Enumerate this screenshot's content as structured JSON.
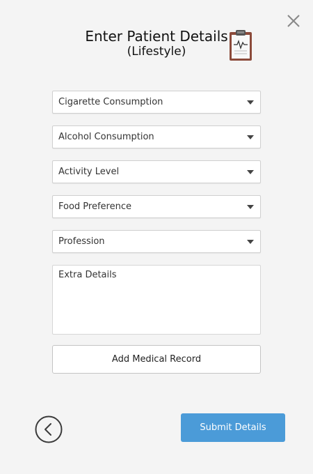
{
  "header": {
    "title": "Enter Patient Details",
    "subtitle": "(Lifestyle)"
  },
  "icons": {
    "close": "close-icon",
    "clipboard": "clipboard-icon",
    "back": "back-arrow-icon",
    "dropdown": "chevron-down-icon"
  },
  "form": {
    "selects": [
      {
        "placeholder": "Cigarette Consumption"
      },
      {
        "placeholder": "Alcohol Consumption"
      },
      {
        "placeholder": "Activity Level"
      },
      {
        "placeholder": "Food Preference"
      },
      {
        "placeholder": "Profession"
      }
    ],
    "extra_details_placeholder": "Extra Details",
    "add_record_label": "Add Medical Record"
  },
  "footer": {
    "submit_label": "Submit Details"
  },
  "colors": {
    "background": "#f4f4f4",
    "submit_button": "#4b9bd8",
    "clipboard_board": "#8b4a3a",
    "clipboard_paper": "#f8f8f8",
    "back_icon": "#3a3a3a"
  }
}
